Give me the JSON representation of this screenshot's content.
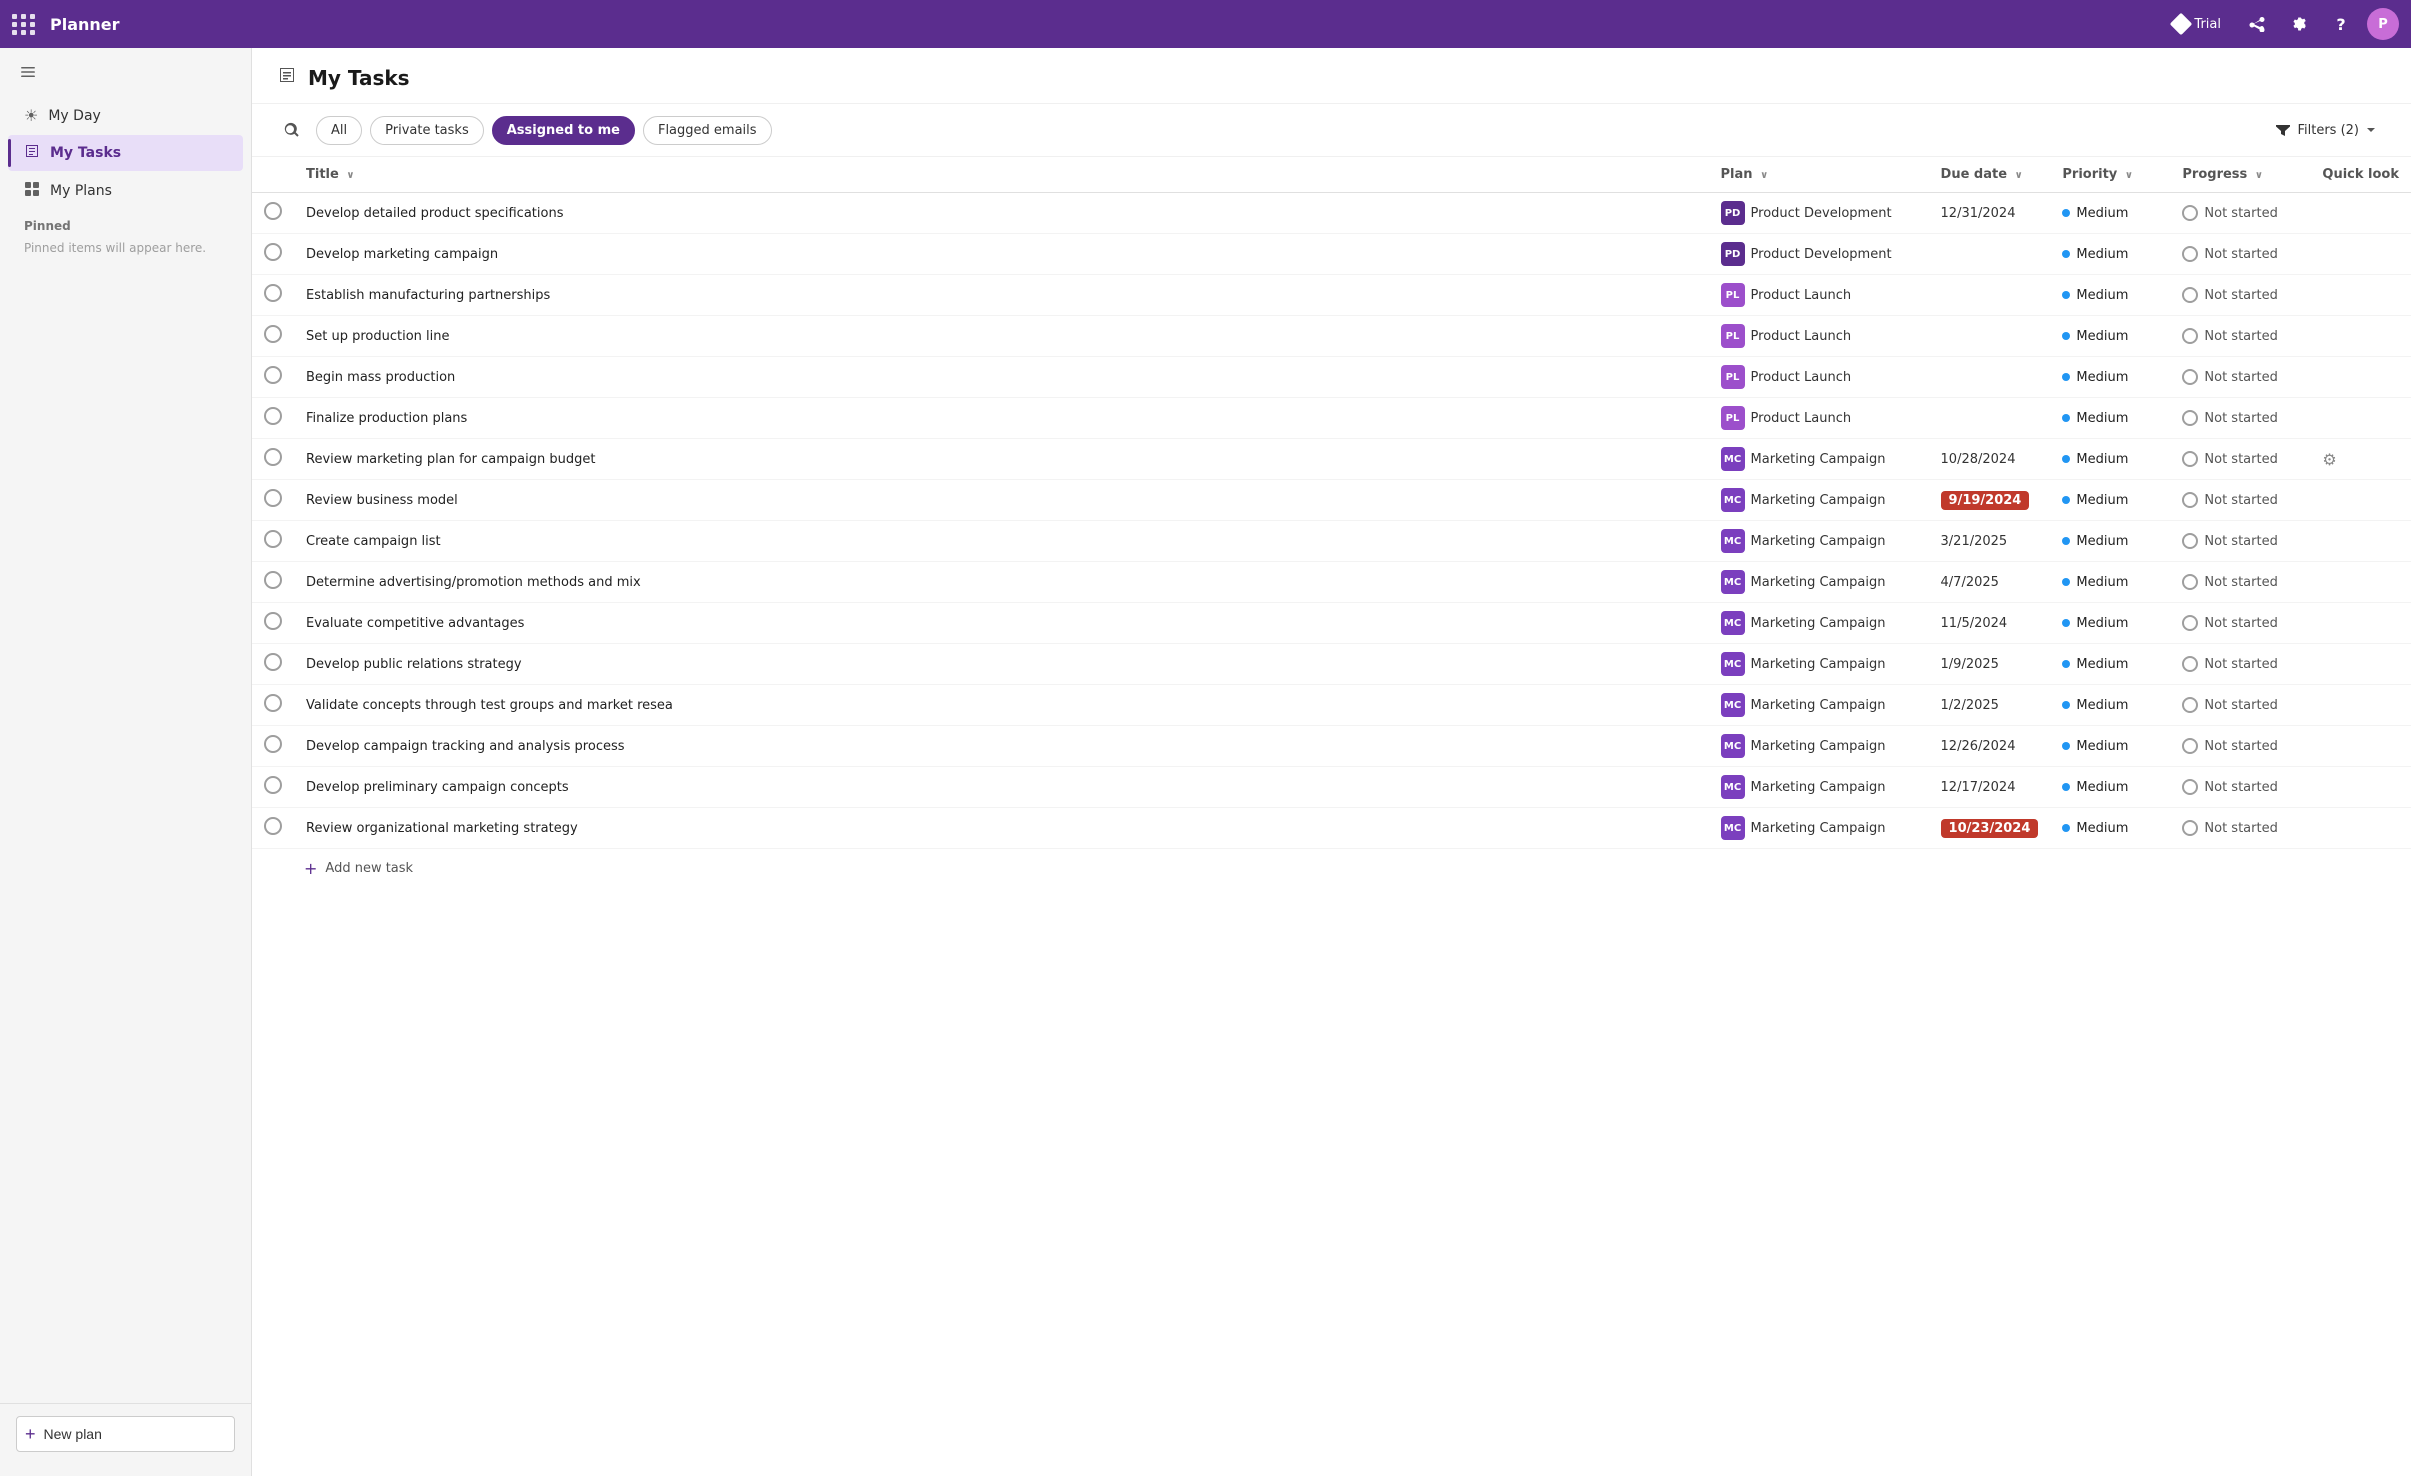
{
  "app": {
    "name": "Planner",
    "trial_label": "Trial"
  },
  "topbar": {
    "dots": 9,
    "icons": [
      "trial",
      "share",
      "settings",
      "help",
      "avatar"
    ]
  },
  "sidebar": {
    "collapse_label": "Collapse",
    "nav_items": [
      {
        "id": "my-day",
        "label": "My Day",
        "icon": "☀"
      },
      {
        "id": "my-tasks",
        "label": "My Tasks",
        "icon": "✔",
        "active": true
      },
      {
        "id": "my-plans",
        "label": "My Plans",
        "icon": "▦"
      }
    ],
    "pinned_section": "Pinned",
    "pinned_empty": "Pinned items will appear here.",
    "new_plan_label": "New plan"
  },
  "header": {
    "title": "My Tasks",
    "icon": "🏠"
  },
  "tabs": {
    "items": [
      {
        "id": "all",
        "label": "All",
        "active": false
      },
      {
        "id": "private-tasks",
        "label": "Private tasks",
        "active": false
      },
      {
        "id": "assigned-to-me",
        "label": "Assigned to me",
        "active": true
      },
      {
        "id": "flagged-emails",
        "label": "Flagged emails",
        "active": false
      }
    ],
    "filter_label": "Filters (2)",
    "filter_count": "2"
  },
  "table": {
    "columns": [
      {
        "id": "check",
        "label": ""
      },
      {
        "id": "title",
        "label": "Title",
        "sort": true
      },
      {
        "id": "plan",
        "label": "Plan",
        "sort": true
      },
      {
        "id": "due_date",
        "label": "Due date",
        "sort": true
      },
      {
        "id": "priority",
        "label": "Priority",
        "sort": true
      },
      {
        "id": "progress",
        "label": "Progress",
        "sort": true
      },
      {
        "id": "quick_look",
        "label": "Quick look",
        "sort": false
      }
    ],
    "rows": [
      {
        "title": "Develop detailed product specifications",
        "plan": "Product Development",
        "plan_abbr": "PD",
        "plan_class": "plan-pd",
        "due_date": "12/31/2024",
        "overdue": false,
        "priority": "Medium",
        "progress": "Not started",
        "has_quick_look": false,
        "has_info": true
      },
      {
        "title": "Develop marketing campaign",
        "plan": "Product Development",
        "plan_abbr": "PD",
        "plan_class": "plan-pd",
        "due_date": "",
        "overdue": false,
        "priority": "Medium",
        "progress": "Not started",
        "has_quick_look": false
      },
      {
        "title": "Establish manufacturing partnerships",
        "plan": "Product Launch",
        "plan_abbr": "PL",
        "plan_class": "plan-pl",
        "due_date": "",
        "overdue": false,
        "priority": "Medium",
        "progress": "Not started",
        "has_quick_look": false
      },
      {
        "title": "Set up production line",
        "plan": "Product Launch",
        "plan_abbr": "PL",
        "plan_class": "plan-pl",
        "due_date": "",
        "overdue": false,
        "priority": "Medium",
        "progress": "Not started",
        "has_quick_look": false
      },
      {
        "title": "Begin mass production",
        "plan": "Product Launch",
        "plan_abbr": "PL",
        "plan_class": "plan-pl",
        "due_date": "",
        "overdue": false,
        "priority": "Medium",
        "progress": "Not started",
        "has_quick_look": false
      },
      {
        "title": "Finalize production plans",
        "plan": "Product Launch",
        "plan_abbr": "PL",
        "plan_class": "plan-pl",
        "due_date": "",
        "overdue": false,
        "priority": "Medium",
        "progress": "Not started",
        "has_quick_look": false
      },
      {
        "title": "Review marketing plan for campaign budget",
        "plan": "Marketing Campaign",
        "plan_abbr": "MC",
        "plan_class": "plan-mc",
        "due_date": "10/28/2024",
        "overdue": false,
        "priority": "Medium",
        "progress": "Not started",
        "has_quick_look": true
      },
      {
        "title": "Review business model",
        "plan": "Marketing Campaign",
        "plan_abbr": "MC",
        "plan_class": "plan-mc",
        "due_date": "9/19/2024",
        "overdue": true,
        "priority": "Medium",
        "progress": "Not started",
        "has_quick_look": false
      },
      {
        "title": "Create campaign list",
        "plan": "Marketing Campaign",
        "plan_abbr": "MC",
        "plan_class": "plan-mc",
        "due_date": "3/21/2025",
        "overdue": false,
        "priority": "Medium",
        "progress": "Not started",
        "has_quick_look": false
      },
      {
        "title": "Determine advertising/promotion methods and mix",
        "plan": "Marketing Campaign",
        "plan_abbr": "MC",
        "plan_class": "plan-mc",
        "due_date": "4/7/2025",
        "overdue": false,
        "priority": "Medium",
        "progress": "Not started",
        "has_quick_look": false
      },
      {
        "title": "Evaluate competitive advantages",
        "plan": "Marketing Campaign",
        "plan_abbr": "MC",
        "plan_class": "plan-mc",
        "due_date": "11/5/2024",
        "overdue": false,
        "priority": "Medium",
        "progress": "Not started",
        "has_quick_look": false
      },
      {
        "title": "Develop public relations strategy",
        "plan": "Marketing Campaign",
        "plan_abbr": "MC",
        "plan_class": "plan-mc",
        "due_date": "1/9/2025",
        "overdue": false,
        "priority": "Medium",
        "progress": "Not started",
        "has_quick_look": false
      },
      {
        "title": "Validate concepts through test groups and market resea",
        "plan": "Marketing Campaign",
        "plan_abbr": "MC",
        "plan_class": "plan-mc",
        "due_date": "1/2/2025",
        "overdue": false,
        "priority": "Medium",
        "progress": "Not started",
        "has_quick_look": false
      },
      {
        "title": "Develop campaign tracking and analysis process",
        "plan": "Marketing Campaign",
        "plan_abbr": "MC",
        "plan_class": "plan-mc",
        "due_date": "12/26/2024",
        "overdue": false,
        "priority": "Medium",
        "progress": "Not started",
        "has_quick_look": false
      },
      {
        "title": "Develop preliminary campaign concepts",
        "plan": "Marketing Campaign",
        "plan_abbr": "MC",
        "plan_class": "plan-mc",
        "due_date": "12/17/2024",
        "overdue": false,
        "priority": "Medium",
        "progress": "Not started",
        "has_quick_look": false
      },
      {
        "title": "Review organizational marketing strategy",
        "plan": "Marketing Campaign",
        "plan_abbr": "MC",
        "plan_class": "plan-mc",
        "due_date": "10/23/2024",
        "overdue": true,
        "priority": "Medium",
        "progress": "Not started",
        "has_quick_look": false
      }
    ],
    "add_task_label": "Add new task"
  }
}
